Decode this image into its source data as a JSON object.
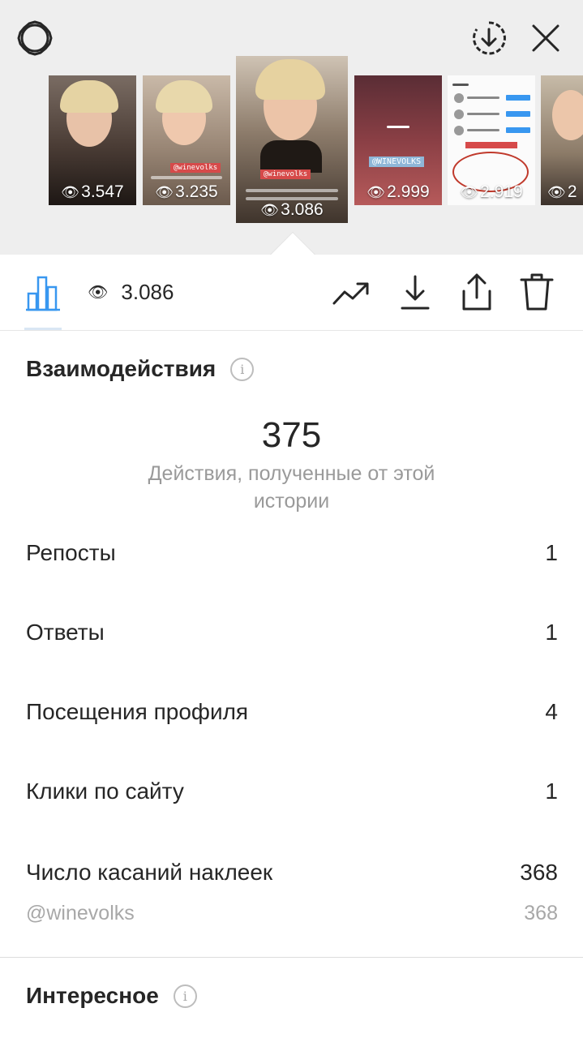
{
  "stories": [
    {
      "views": "3.547"
    },
    {
      "views": "3.235",
      "tag": "@winevolks"
    },
    {
      "views": "3.086",
      "tag": "@winevolks",
      "selected": true
    },
    {
      "views": "2.999",
      "tag": "@WINEVOLKS"
    },
    {
      "views": "2.919"
    },
    {
      "views": "2"
    }
  ],
  "toolbar": {
    "views": "3.086"
  },
  "interactions": {
    "title": "Взаимодействия",
    "total": "375",
    "total_caption": "Действия, полученные от этой истории",
    "rows": [
      {
        "label": "Репосты",
        "value": "1"
      },
      {
        "label": "Ответы",
        "value": "1"
      },
      {
        "label": "Посещения профиля",
        "value": "4"
      },
      {
        "label": "Клики по сайту",
        "value": "1"
      },
      {
        "label": "Число касаний наклеек",
        "value": "368"
      }
    ],
    "sticker_sub": {
      "label": "@winevolks",
      "value": "368"
    }
  },
  "discovery": {
    "title": "Интересное"
  },
  "colors": {
    "accent": "#3897f0",
    "tag_red": "#d64a4a",
    "muted_text": "#9a9a9a"
  },
  "icons": {
    "settings": "gear-icon",
    "save": "download-circle-icon",
    "close": "close-icon",
    "insights": "bar-chart-icon",
    "views": "eye-icon",
    "promote": "trend-arrow-icon",
    "download": "download-icon",
    "share": "share-icon",
    "delete": "trash-icon",
    "info": "info-icon"
  }
}
